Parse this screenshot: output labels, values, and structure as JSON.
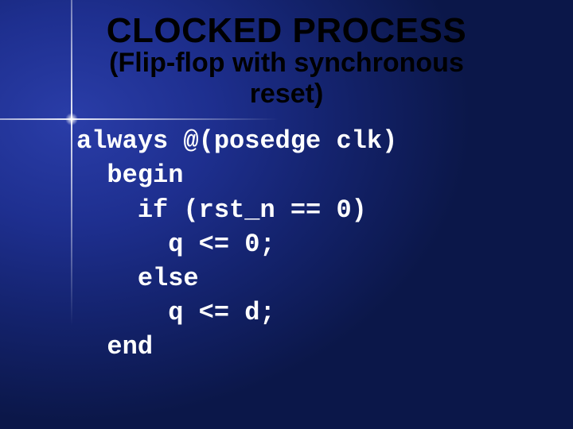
{
  "title": "CLOCKED PROCESS",
  "subtitle_line1": "(Flip-flop with synchronous",
  "subtitle_line2": "reset)",
  "code": {
    "l1": "always @(posedge clk)",
    "l2": "  begin",
    "l3": "    if (rst_n == 0)",
    "l4": "      q <= 0;",
    "l5": "    else",
    "l6": "      q <= d;",
    "l7": "  end"
  }
}
